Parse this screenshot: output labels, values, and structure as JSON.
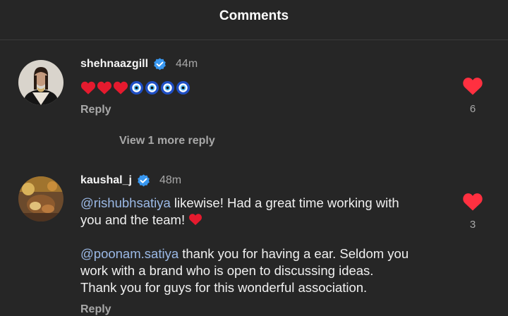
{
  "header": {
    "title": "Comments"
  },
  "comments": [
    {
      "username": "shehnaazgill",
      "verified": true,
      "time": "44m",
      "emojis": [
        "red-heart",
        "red-heart",
        "red-heart",
        "nazar-amulet",
        "nazar-amulet",
        "nazar-amulet",
        "nazar-amulet"
      ],
      "reply_label": "Reply",
      "likes": "6",
      "view_more": "View 1 more reply"
    },
    {
      "username": "kaushal_j",
      "verified": true,
      "time": "48m",
      "para1": {
        "mention": "@rishubhsatiya",
        "line1": " likewise! Had a great time working with",
        "line2": "you and the team! "
      },
      "para2": {
        "mention": "@poonam.satiya",
        "line1": " thank you for having a ear. Seldom you",
        "line2": "work with a brand who is open to discussing ideas.",
        "line3": "Thank you for guys for this wonderful association."
      },
      "reply_label": "Reply",
      "likes": "3"
    }
  ],
  "colors": {
    "background": "#262626",
    "heart": "#ff3040",
    "verified": "#3897f0",
    "mention": "#9bb9e6",
    "muted": "#a8a8a8"
  }
}
